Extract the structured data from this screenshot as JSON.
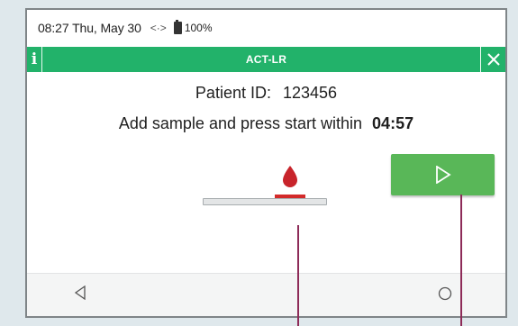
{
  "status_bar": {
    "time": "08:27 Thu, May 30",
    "sync_icon": "<·>",
    "battery": "100%"
  },
  "title_bar": {
    "title": "ACT-LR",
    "info_icon": "i",
    "close_icon": "close-icon"
  },
  "patient": {
    "label": "Patient ID:",
    "id": "123456"
  },
  "instruction": {
    "text": "Add sample and press start within",
    "timer": "04:57"
  },
  "colors": {
    "accent": "#22b26a",
    "start_button": "#59b758",
    "drop": "#c8242b",
    "callout": "#8d2b58"
  },
  "icons": {
    "drop": "blood-drop-icon",
    "start": "play-icon",
    "nav_back": "nav-back-icon",
    "nav_home": "nav-home-icon"
  }
}
